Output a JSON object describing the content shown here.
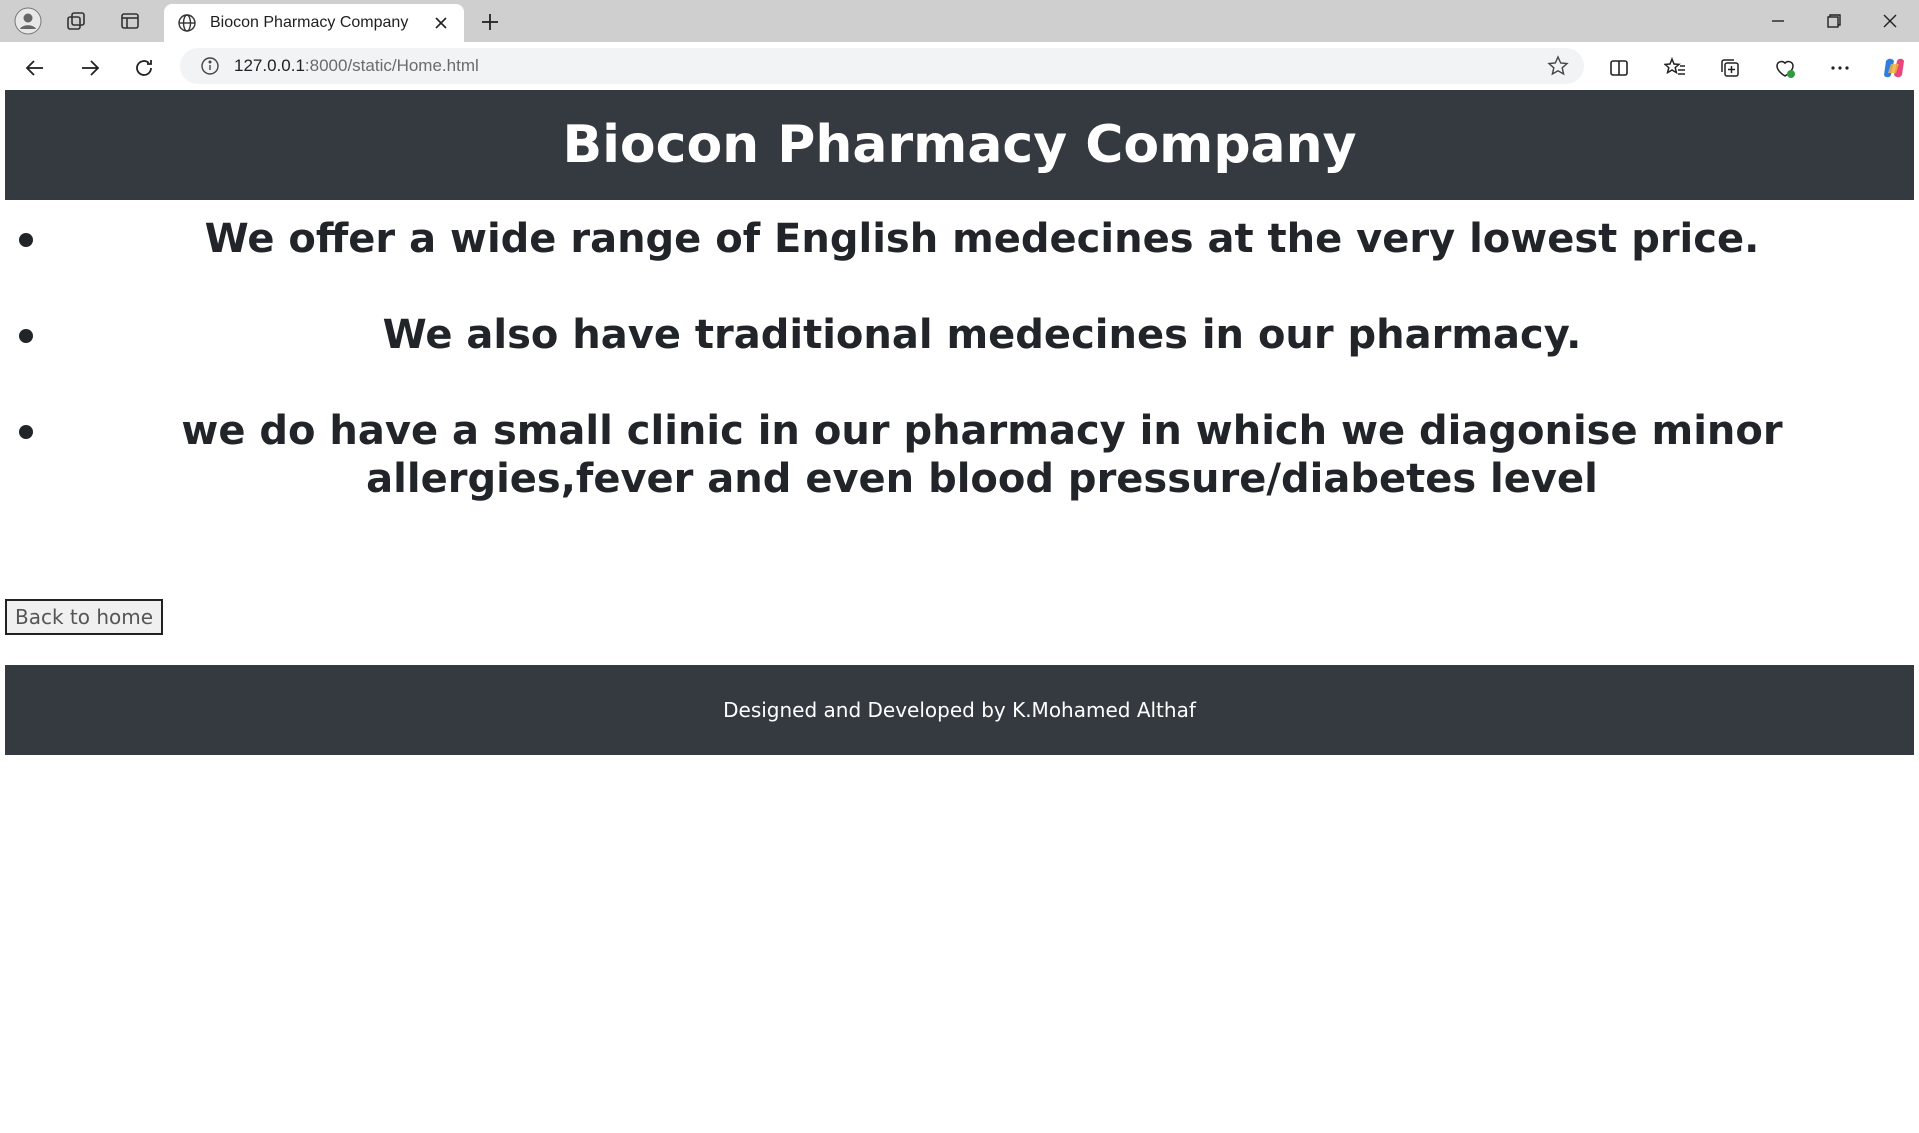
{
  "browser": {
    "tab_title": "Biocon Pharmacy Company",
    "url_host": "127.0.0.1",
    "url_rest": ":8000/static/Home.html"
  },
  "page": {
    "header_title": "Biocon Pharmacy Company",
    "features": [
      "We offer a wide range of English medecines at the very lowest price.",
      "We also have traditional medecines in our pharmacy.",
      "we do have a small clinic in our pharmacy in which we diagonise minor allergies,fever and even blood pressure/diabetes level"
    ],
    "back_button_label": "Back to home",
    "footer_text": "Designed and Developed by K.Mohamed Althaf"
  },
  "colors": {
    "header_bg": "#343a40",
    "footer_bg": "#343a40",
    "text": "#212529"
  }
}
